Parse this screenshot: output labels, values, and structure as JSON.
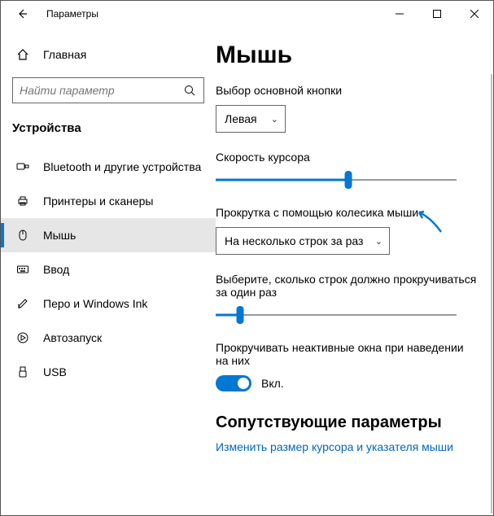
{
  "titlebar": {
    "title": "Параметры"
  },
  "sidebar": {
    "home_label": "Главная",
    "search_placeholder": "Найти параметр",
    "section_title": "Устройства",
    "items": [
      {
        "label": "Bluetooth и другие устройства"
      },
      {
        "label": "Принтеры и сканеры"
      },
      {
        "label": "Мышь"
      },
      {
        "label": "Ввод"
      },
      {
        "label": "Перо и Windows Ink"
      },
      {
        "label": "Автозапуск"
      },
      {
        "label": "USB"
      }
    ]
  },
  "page": {
    "title": "Мышь",
    "primary_button": {
      "label": "Выбор основной кнопки",
      "value": "Левая"
    },
    "cursor_speed": {
      "label": "Скорость курсора",
      "pct": 55
    },
    "scroll_mode": {
      "label": "Прокрутка с помощью колесика мыши",
      "value": "На несколько строк за раз"
    },
    "lines_per_scroll": {
      "label": "Выберите, сколько строк должно прокручиваться за один раз",
      "pct": 10
    },
    "inactive": {
      "label": "Прокручивать неактивные окна при наведении на них",
      "state": "Вкл."
    },
    "related": {
      "heading": "Сопутствующие параметры",
      "link": "Изменить размер курсора и указателя мыши"
    }
  }
}
